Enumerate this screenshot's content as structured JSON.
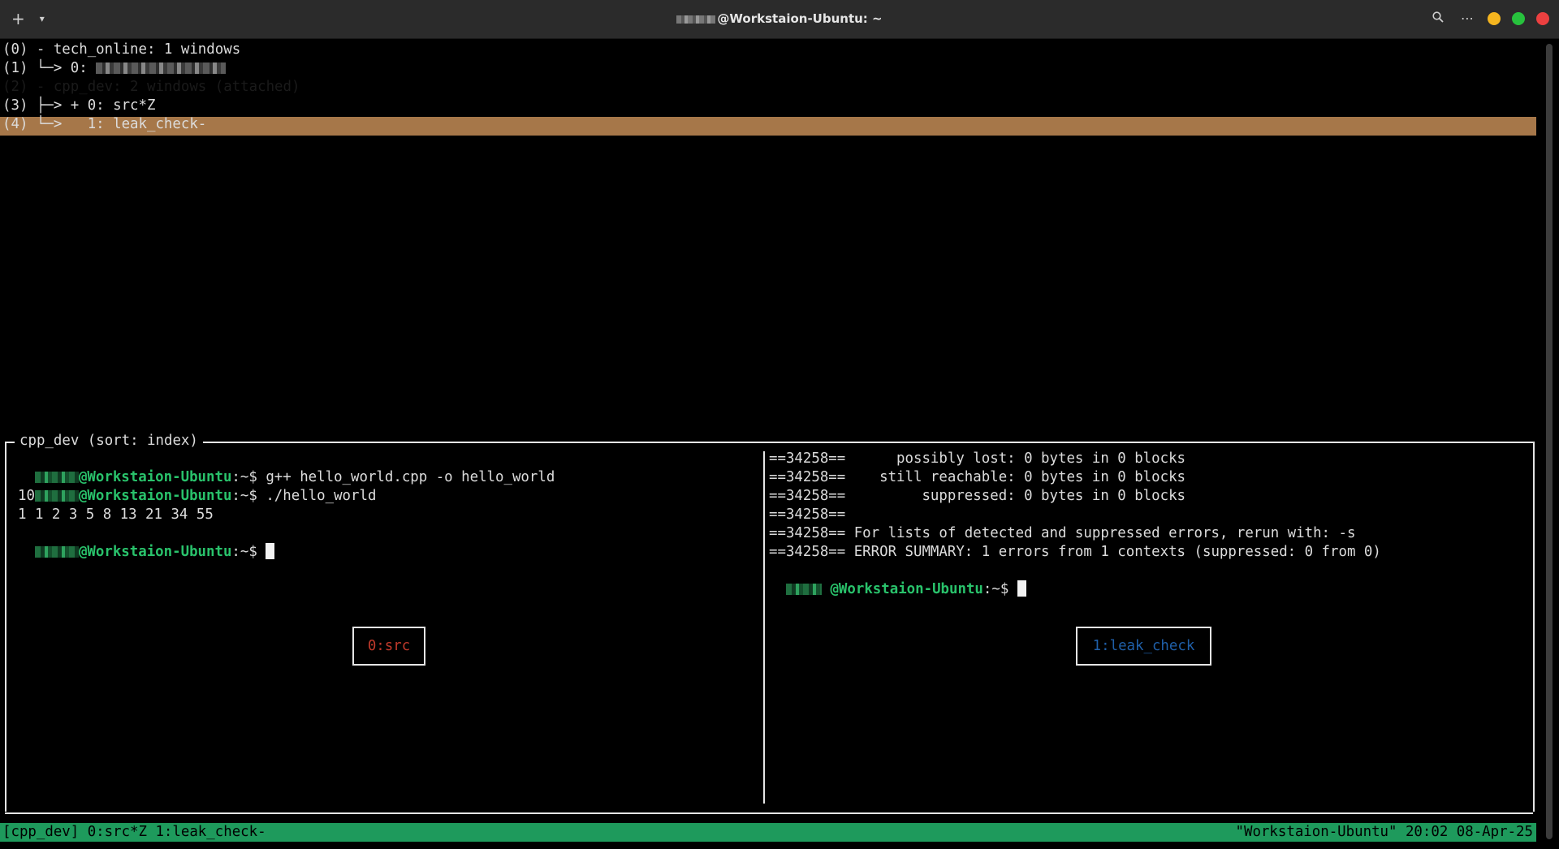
{
  "titlebar": {
    "title": "@Workstaion-Ubuntu: ~",
    "new_tab_icon": "plus-icon",
    "dropdown_icon": "chevron-down-icon",
    "search_icon": "search-icon",
    "menu_icon": "more-icon"
  },
  "tree": {
    "l0": "(0) - tech_online: 1 windows",
    "l1a": "(1) └─> 0: ",
    "l2": "(2) - cpp_dev: 2 windows (attached)",
    "l3": "(3) ├─> + 0: src*Z",
    "l4": "(4) └─>   1: leak_check-"
  },
  "preview": {
    "title": "cpp_dev (sort: index)"
  },
  "left_pane": {
    "host": "@Workstaion-Ubuntu",
    "suffix": ":~$ ",
    "cmd1": "g++ hello_world.cpp -o hello_world",
    "cmd2": "./hello_world",
    "out1": "10",
    "out2": "1 1 2 3 5 8 13 21 34 55",
    "label": "0:src"
  },
  "right_pane": {
    "r1": "==34258==      possibly lost: 0 bytes in 0 blocks",
    "r2": "==34258==    still reachable: 0 bytes in 0 blocks",
    "r3": "==34258==         suppressed: 0 bytes in 0 blocks",
    "r4": "==34258==",
    "r5": "==34258== For lists of detected and suppressed errors, rerun with: -s",
    "r6": "==34258== ERROR SUMMARY: 1 errors from 1 contexts (suppressed: 0 from 0)",
    "host": "@Workstaion-Ubuntu",
    "suffix": ":~$ ",
    "label": "1:leak_check"
  },
  "statusbar": {
    "left": "[cpp_dev] 0:src*Z 1:leak_check-",
    "right": "\"Workstaion-Ubuntu\" 20:02 08-Apr-25"
  },
  "colors": {
    "highlight": "#a67749",
    "status_bg": "#1e9a5c",
    "prompt_green": "#29c26b",
    "src_label": "#c0392b",
    "leak_label": "#1f5fa8"
  }
}
